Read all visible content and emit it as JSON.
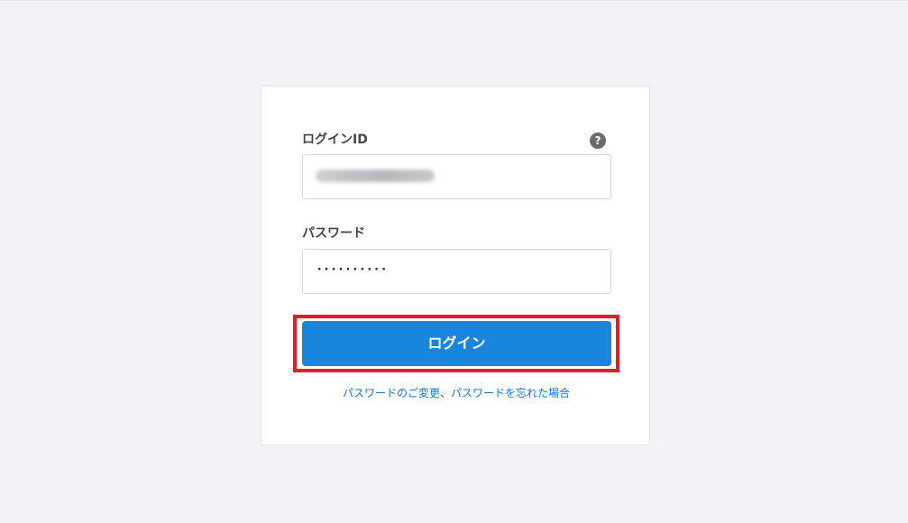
{
  "login_form": {
    "login_id_label": "ログインID",
    "help_icon_glyph": "?",
    "login_id_value_blurred": true,
    "password_label": "パスワード",
    "password_value_masked": "··········",
    "login_button_label": "ログイン",
    "forgot_password_link": "パスワードのご変更、パスワードを忘れた場合"
  },
  "colors": {
    "page_background": "#f2f3f7",
    "button": "#1a85dd",
    "link": "#1a73c8",
    "highlight": "#dd1f26"
  },
  "icons": {
    "help": "help-icon"
  }
}
